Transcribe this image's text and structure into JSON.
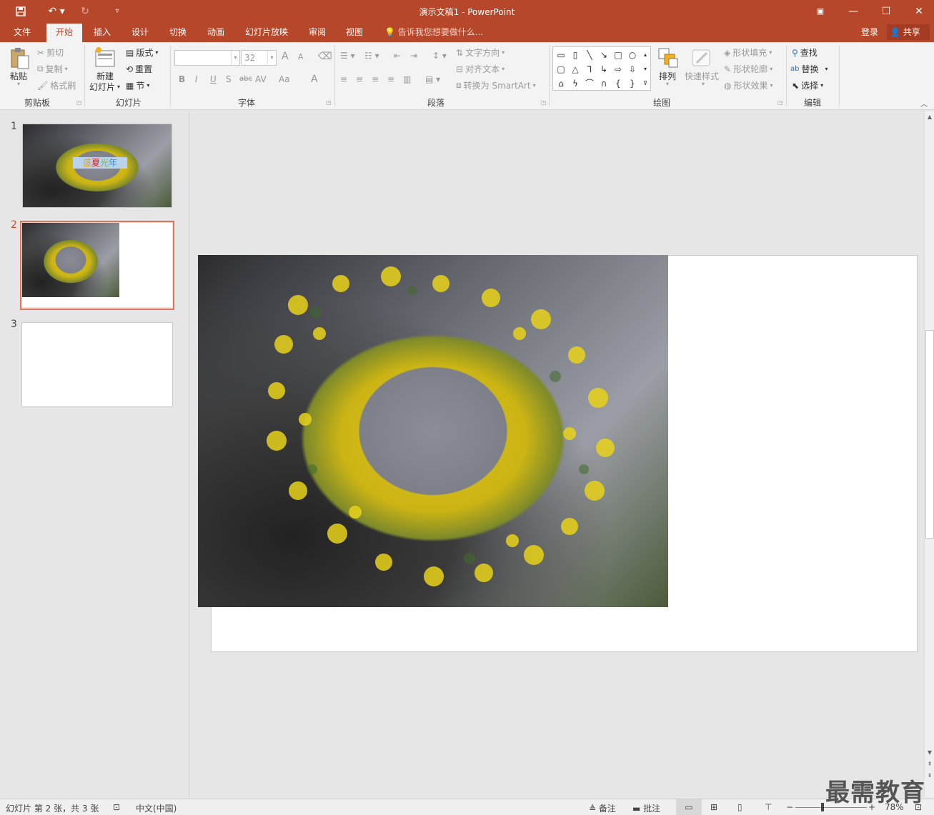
{
  "window": {
    "title": "演示文稿1 - PowerPoint",
    "minimize_icon": "minimize-icon",
    "maximize_icon": "maximize-icon",
    "close_icon": "close-icon"
  },
  "quick_access": {
    "save": "save-icon",
    "undo": "undo-icon",
    "redo": "redo-icon",
    "customize": "customize-icon"
  },
  "tabs": [
    "文件",
    "开始",
    "插入",
    "设计",
    "切换",
    "动画",
    "幻灯片放映",
    "审阅",
    "视图"
  ],
  "active_tab": "开始",
  "tell_me": "告诉我您想要做什么...",
  "account": {
    "login": "登录",
    "share": "共享"
  },
  "ribbon": {
    "clipboard": {
      "label": "剪贴板",
      "paste": "粘贴",
      "cut": "剪切",
      "copy": "复制",
      "format_painter": "格式刷"
    },
    "slides": {
      "label": "幻灯片",
      "new_slide_line1": "新建",
      "new_slide_line2": "幻灯片",
      "layout": "版式",
      "reset": "重置",
      "section": "节"
    },
    "font": {
      "label": "字体",
      "font_name": "",
      "font_size": "32",
      "bold": "B",
      "italic": "I",
      "underline": "U",
      "shadow": "S",
      "strike": "abc",
      "spacing": "AV",
      "case": "Aa",
      "color": "A",
      "grow": "A",
      "shrink": "A"
    },
    "paragraph": {
      "label": "段落",
      "text_direction": "文字方向",
      "align_text": "对齐文本",
      "smartart": "转换为 SmartArt"
    },
    "drawing": {
      "label": "绘图",
      "arrange": "排列",
      "quick_styles": "快速样式",
      "shape_fill": "形状填充",
      "shape_outline": "形状轮廓",
      "shape_effects": "形状效果"
    },
    "editing": {
      "label": "编辑",
      "find": "查找",
      "replace": "替换",
      "select": "选择"
    }
  },
  "slides": [
    {
      "number": "1",
      "caption_parts": [
        "盛",
        "夏",
        "光",
        "年"
      ],
      "caption_colors": [
        "#e8a020",
        "#d02020",
        "#7ab84a",
        "#4a90d0"
      ]
    },
    {
      "number": "2"
    },
    {
      "number": "3"
    }
  ],
  "selected_slide": 2,
  "status": {
    "slide_info": "幻灯片 第 2 张，共 3 张",
    "language": "中文(中国)",
    "notes": "备注",
    "comments": "批注",
    "zoom": "78%",
    "zoom_percent": 78
  },
  "watermark": "最需教育",
  "colors": {
    "accent": "#b7472a",
    "selection": "#e5735a"
  }
}
